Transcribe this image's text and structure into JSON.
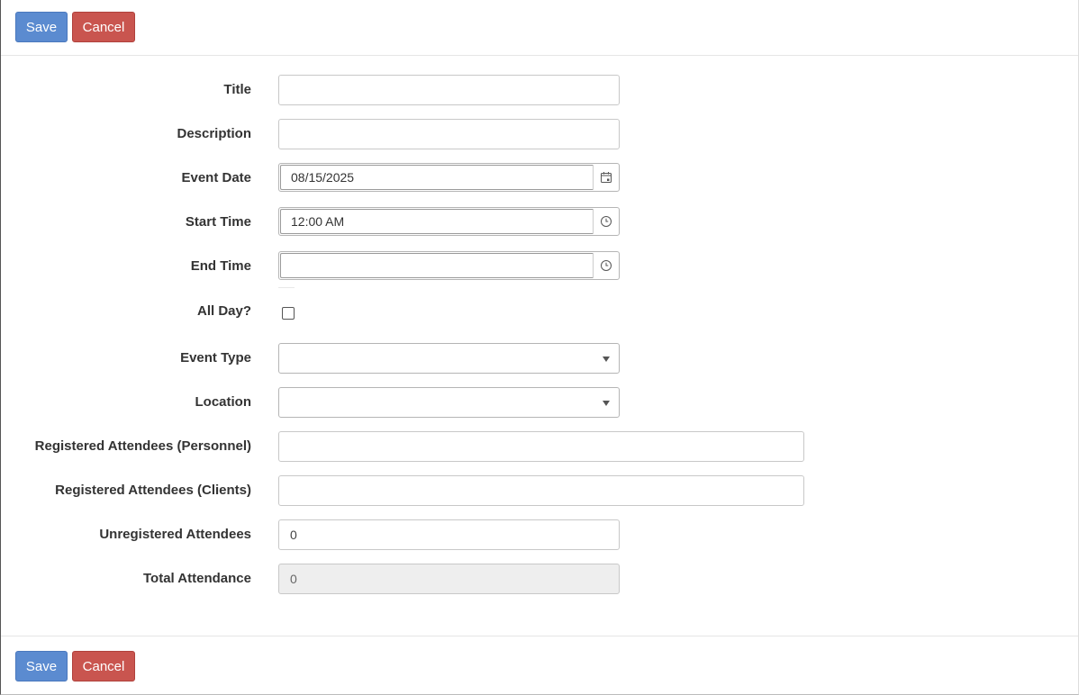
{
  "toolbar": {
    "save_label": "Save",
    "cancel_label": "Cancel"
  },
  "form": {
    "title": {
      "label": "Title",
      "value": ""
    },
    "description": {
      "label": "Description",
      "value": ""
    },
    "event_date": {
      "label": "Event Date",
      "value": "08/15/2025",
      "icon": "calendar-icon"
    },
    "start_time": {
      "label": "Start Time",
      "value": "12:00 AM",
      "icon": "clock-icon"
    },
    "end_time": {
      "label": "End Time",
      "value": "",
      "icon": "clock-icon"
    },
    "all_day": {
      "label": "All Day?",
      "checked": false
    },
    "event_type": {
      "label": "Event Type",
      "selected": ""
    },
    "location": {
      "label": "Location",
      "selected": ""
    },
    "registered_personnel": {
      "label": "Registered Attendees (Personnel)",
      "value": ""
    },
    "registered_clients": {
      "label": "Registered Attendees (Clients)",
      "value": ""
    },
    "unregistered": {
      "label": "Unregistered Attendees",
      "value": "0"
    },
    "total_attendance": {
      "label": "Total Attendance",
      "value": "0"
    }
  },
  "colors": {
    "save": "#5b8bd0",
    "cancel": "#c9554f",
    "disabled_bg": "#eeeeee"
  }
}
